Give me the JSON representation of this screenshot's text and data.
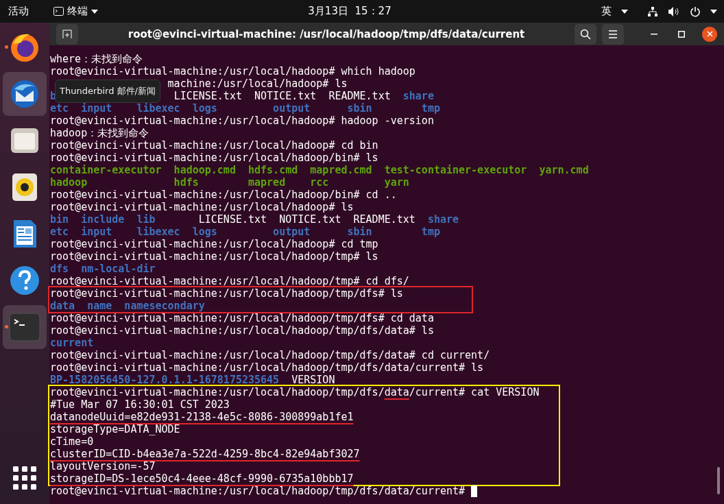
{
  "top_bar": {
    "activities": "活动",
    "app_menu": "终端",
    "clock": "3月13日  15：27",
    "input_method": "英"
  },
  "dock": {
    "items": [
      {
        "kind": "browser",
        "highlighted": false,
        "running": true
      },
      {
        "kind": "mail",
        "highlighted": true,
        "running": false
      },
      {
        "kind": "files",
        "highlighted": false,
        "running": false
      },
      {
        "kind": "music",
        "highlighted": false,
        "running": false
      },
      {
        "kind": "writer",
        "highlighted": false,
        "running": false
      },
      {
        "kind": "help",
        "highlighted": false,
        "running": false
      },
      {
        "kind": "terminal",
        "highlighted": true,
        "running": true
      }
    ],
    "tooltip": "Thunderbird 邮件/新闻"
  },
  "window": {
    "title": "root@evinci-virtual-machine: /usr/local/hadoop/tmp/dfs/data/current"
  },
  "terminal": {
    "blocks": [
      {
        "kind": "plain",
        "lines": [
          [
            {
              "text": "where：未找到命令",
              "kind": "text",
              "underlined": false
            }
          ],
          [
            {
              "text": "root@evinci-virtual-machine:/usr/local/hadoop# which hadoop",
              "kind": "text",
              "underlined": false
            }
          ],
          [
            {
              "text": "                   machine:/usr/local/hadoop# ls",
              "kind": "text",
              "underlined": false
            }
          ],
          [
            {
              "text": "b",
              "kind": "dir",
              "underlined": false
            },
            {
              "text": "                   LICENSE.txt  NOTICE.txt  README.txt  ",
              "kind": "text",
              "underlined": false
            },
            {
              "text": "share",
              "kind": "dir",
              "underlined": false
            }
          ],
          [
            {
              "text": "etc  input    libexec  logs         output      sbin        tmp",
              "kind": "dir",
              "underlined": false
            }
          ],
          [
            {
              "text": "root@evinci-virtual-machine:/usr/local/hadoop# hadoop -version",
              "kind": "text",
              "underlined": false
            }
          ],
          [
            {
              "text": "hadoop：未找到命令",
              "kind": "text",
              "underlined": false
            }
          ],
          [
            {
              "text": "root@evinci-virtual-machine:/usr/local/hadoop# cd bin",
              "kind": "text",
              "underlined": false
            }
          ],
          [
            {
              "text": "root@evinci-virtual-machine:/usr/local/hadoop/bin# ls",
              "kind": "text",
              "underlined": false
            }
          ],
          [
            {
              "text": "container-executor  hadoop.cmd  hdfs.cmd  mapred.cmd  test-container-executor  yarn.cmd",
              "kind": "exec",
              "underlined": false
            }
          ],
          [
            {
              "text": "hadoop              hdfs        mapred    rcc         yarn",
              "kind": "exec",
              "underlined": false
            }
          ],
          [
            {
              "text": "root@evinci-virtual-machine:/usr/local/hadoop/bin# cd ..",
              "kind": "text",
              "underlined": false
            }
          ],
          [
            {
              "text": "root@evinci-virtual-machine:/usr/local/hadoop# ls",
              "kind": "text",
              "underlined": false
            }
          ],
          [
            {
              "text": "bin  include  lib      ",
              "kind": "dir",
              "underlined": false
            },
            {
              "text": " LICENSE.txt  NOTICE.txt  README.txt  ",
              "kind": "text",
              "underlined": false
            },
            {
              "text": "share",
              "kind": "dir",
              "underlined": false
            }
          ],
          [
            {
              "text": "etc  input    libexec  logs         output      sbin        tmp",
              "kind": "dir",
              "underlined": false
            }
          ],
          [
            {
              "text": "root@evinci-virtual-machine:/usr/local/hadoop# cd tmp",
              "kind": "text",
              "underlined": false
            }
          ],
          [
            {
              "text": "root@evinci-virtual-machine:/usr/local/hadoop/tmp# ls",
              "kind": "text",
              "underlined": false
            }
          ],
          [
            {
              "text": "dfs  nm-local-dir",
              "kind": "dir",
              "underlined": false
            }
          ],
          [
            {
              "text": "root@evinci-virtual-machine:/usr/local/hadoop/tmp# cd dfs/",
              "kind": "text",
              "underlined": false
            }
          ]
        ]
      },
      {
        "kind": "boxed",
        "color": "#e0262b",
        "lines": [
          [
            {
              "text": "root@evinci-virtual-machine:/usr/local/hadoop/tmp/dfs# ls",
              "kind": "text",
              "underlined": false
            }
          ],
          [
            {
              "text": "data  name  namesecondary",
              "kind": "dir",
              "underlined": false
            }
          ]
        ]
      },
      {
        "kind": "plain",
        "lines": [
          [
            {
              "text": "root@evinci-virtual-machine:/usr/local/hadoop/tmp/dfs# cd data",
              "kind": "text",
              "underlined": false
            }
          ],
          [
            {
              "text": "root@evinci-virtual-machine:/usr/local/hadoop/tmp/dfs/data# ls",
              "kind": "text",
              "underlined": false
            }
          ],
          [
            {
              "text": "current",
              "kind": "dir",
              "underlined": false
            }
          ],
          [
            {
              "text": "root@evinci-virtual-machine:/usr/local/hadoop/tmp/dfs/data# cd current/",
              "kind": "text",
              "underlined": false
            }
          ],
          [
            {
              "text": "root@evinci-virtual-machine:/usr/local/hadoop/tmp/dfs/data/current# ls",
              "kind": "text",
              "underlined": false
            }
          ],
          [
            {
              "text": "BP-1582056450-127.0.1.1-1678175235645",
              "kind": "dir",
              "underlined": false
            },
            {
              "text": "  VERSION",
              "kind": "text",
              "underlined": false
            }
          ]
        ]
      },
      {
        "kind": "boxed",
        "color": "#ffee00",
        "lines": [
          [
            {
              "text": "root@evinci-virtual-machine:/usr/local/hadoop/tmp/dfs/",
              "kind": "text",
              "underlined": false
            },
            {
              "text": "data",
              "kind": "text",
              "underlined": true
            },
            {
              "text": "/current# cat VERSION",
              "kind": "text",
              "underlined": false
            }
          ],
          [
            {
              "text": "#Tue Mar 07 16:30:01 CST 2023",
              "kind": "text",
              "underlined": false
            }
          ],
          [
            {
              "text": "datanodeUuid=e82de931-2138-4e5c-8086-300899ab1fe1",
              "kind": "text",
              "underlined": true
            }
          ],
          [
            {
              "text": "storageType=DATA_NODE",
              "kind": "text",
              "underlined": false
            }
          ],
          [
            {
              "text": "cTime=0",
              "kind": "text",
              "underlined": false
            }
          ],
          [
            {
              "text": "clusterID=CID-b4ea3e7a-522d-4259-8bc4-82e94abf3027",
              "kind": "text",
              "underlined": true
            }
          ],
          [
            {
              "text": "layoutVersion=-57",
              "kind": "text",
              "underlined": false
            }
          ],
          [
            {
              "text": "storageID=DS-1ece50c4-4eee-48cf-9990-6735a10bbb17",
              "kind": "text",
              "underlined": true
            }
          ]
        ]
      },
      {
        "kind": "prompt",
        "lines": [
          [
            {
              "text": "root@evinci-virtual-machine:/usr/local/hadoop/tmp/dfs/data/current# ",
              "kind": "text",
              "underlined": false
            }
          ]
        ]
      }
    ]
  }
}
